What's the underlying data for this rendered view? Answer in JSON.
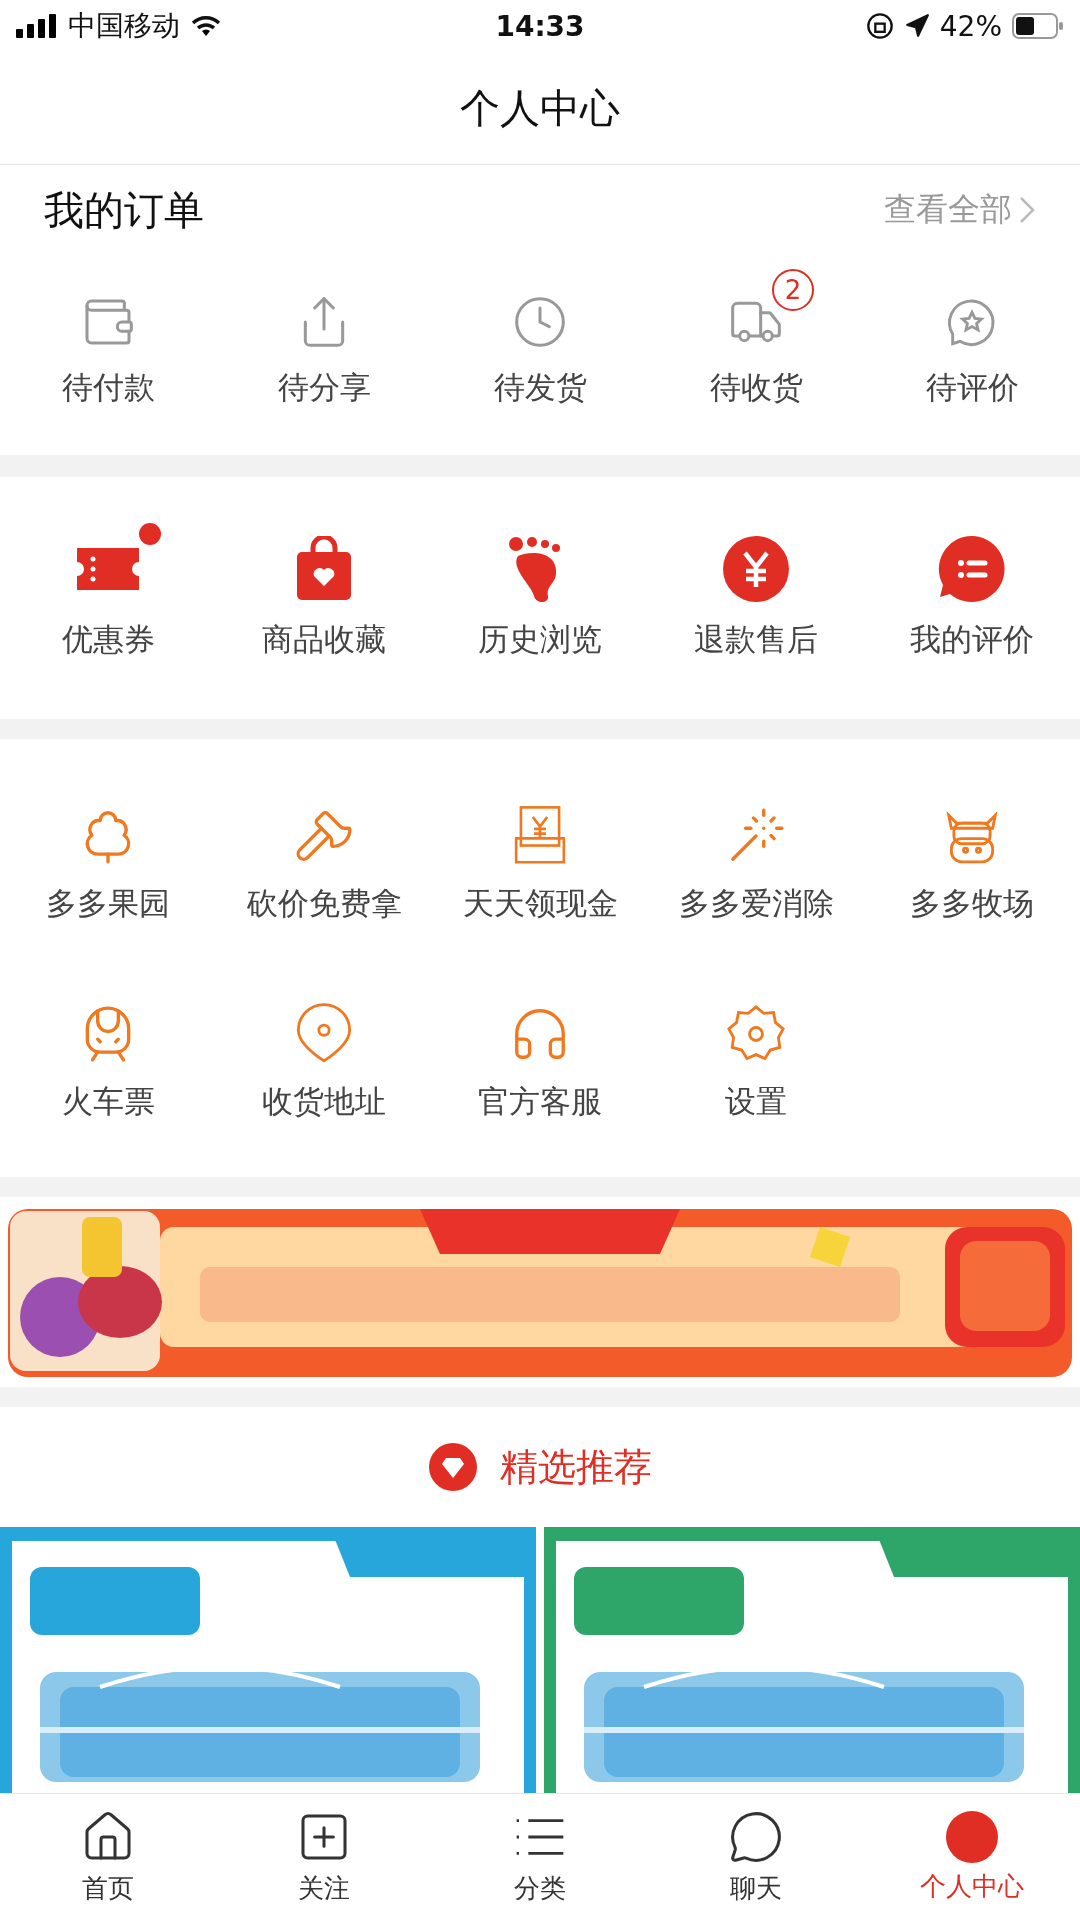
{
  "status_bar": {
    "carrier": "中国移动",
    "time": "14:33",
    "battery": "42%"
  },
  "title": "个人中心",
  "orders": {
    "title": "我的订单",
    "view_all": "查看全部",
    "items": [
      {
        "label": "待付款"
      },
      {
        "label": "待分享"
      },
      {
        "label": "待发货"
      },
      {
        "label": "待收货",
        "badge": "2"
      },
      {
        "label": "待评价"
      }
    ]
  },
  "shortcuts": [
    {
      "label": "优惠券",
      "dot": true
    },
    {
      "label": "商品收藏",
      "dot": false
    },
    {
      "label": "历史浏览",
      "dot": false
    },
    {
      "label": "退款售后",
      "dot": false
    },
    {
      "label": "我的评价",
      "dot": false
    }
  ],
  "services": [
    {
      "label": "多多果园"
    },
    {
      "label": "砍价免费拿"
    },
    {
      "label": "天天领现金"
    },
    {
      "label": "多多爱消除"
    },
    {
      "label": "多多牧场"
    },
    {
      "label": "火车票"
    },
    {
      "label": "收货地址"
    },
    {
      "label": "官方客服"
    },
    {
      "label": "设置"
    }
  ],
  "recommend": {
    "title": "精选推荐"
  },
  "tab_bar": [
    {
      "label": "首页",
      "selected": false
    },
    {
      "label": "关注",
      "selected": false
    },
    {
      "label": "分类",
      "selected": false
    },
    {
      "label": "聊天",
      "selected": false
    },
    {
      "label": "个人中心",
      "selected": true
    }
  ]
}
